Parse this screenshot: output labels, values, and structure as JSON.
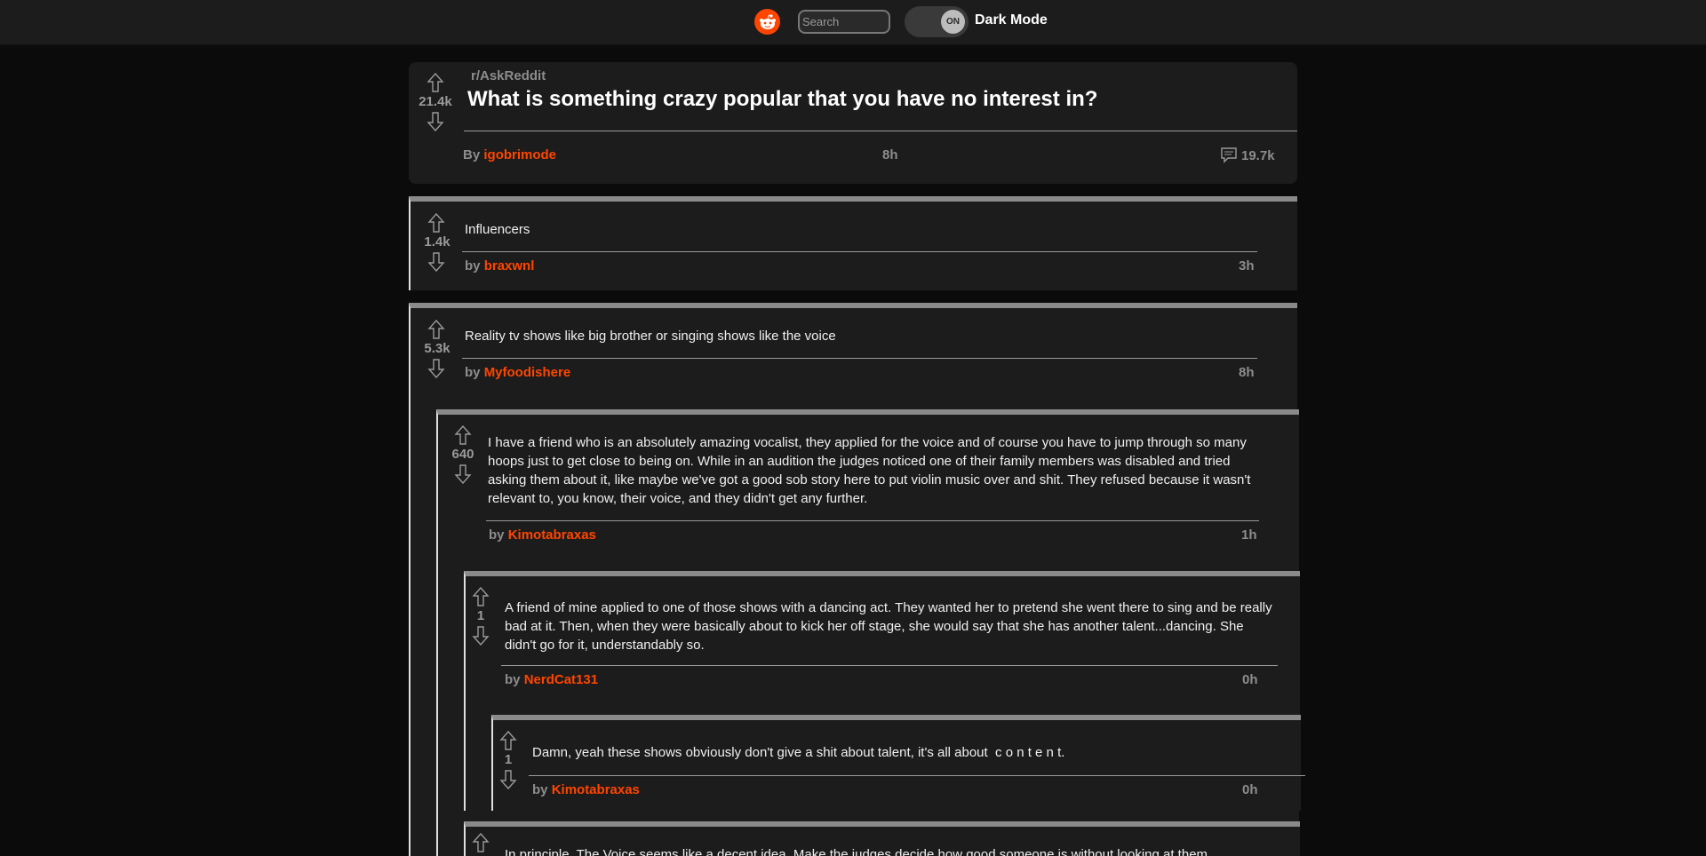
{
  "header": {
    "search_placeholder": "Search",
    "toggle_state": "ON",
    "mode_label": "Dark Mode",
    "accent": "#ff4500"
  },
  "post": {
    "subreddit": "r/AskReddit",
    "score": "21.4k",
    "title": "What is something crazy popular that you have no interest in?",
    "by_label": "By",
    "author": "igobrimode",
    "age": "8h",
    "comment_count": "19.7k"
  },
  "comments": [
    {
      "score": "1.4k",
      "text": "Influencers",
      "by_label": "by",
      "author": "braxwnl",
      "age": "3h"
    },
    {
      "score": "5.3k",
      "text": "Reality tv shows like big brother or singing shows like the voice",
      "by_label": "by",
      "author": "Myfoodishere",
      "age": "8h"
    },
    {
      "score": "640",
      "text": "I have a friend who is an absolutely amazing vocalist, they applied for the voice and of course you have to jump through so many hoops just to get close to being on. While in an audition the judges noticed one of their family members was disabled and tried asking them about it, like maybe we've got a good sob story here to put violin music over and shit. They refused because it wasn't relevant to, you know, their voice, and they didn't get any further.",
      "by_label": "by",
      "author": "Kimotabraxas",
      "age": "1h"
    },
    {
      "score": "1",
      "text": "A friend of mine applied to one of those shows with a dancing act. They wanted her to pretend she went there to sing and be really bad at it. Then, when they were basically about to kick her off stage, she would say that she has another talent...dancing. She didn't go for it, understandably so.",
      "by_label": "by",
      "author": "NerdCat131",
      "age": "0h"
    },
    {
      "score": "1",
      "text": "Damn, yeah these shows obviously don't give a shit about talent, it's all about  c o n t e n t.",
      "by_label": "by",
      "author": "Kimotabraxas",
      "age": "0h"
    },
    {
      "text": "In principle, The Voice seems like a decent idea. Make the judges decide how good someone is without looking at them"
    }
  ],
  "icons": {
    "logo": "reddit-logo-icon",
    "upvote": "upvote-arrow-icon",
    "downvote": "downvote-arrow-icon",
    "comments": "comment-bubble-icon"
  }
}
